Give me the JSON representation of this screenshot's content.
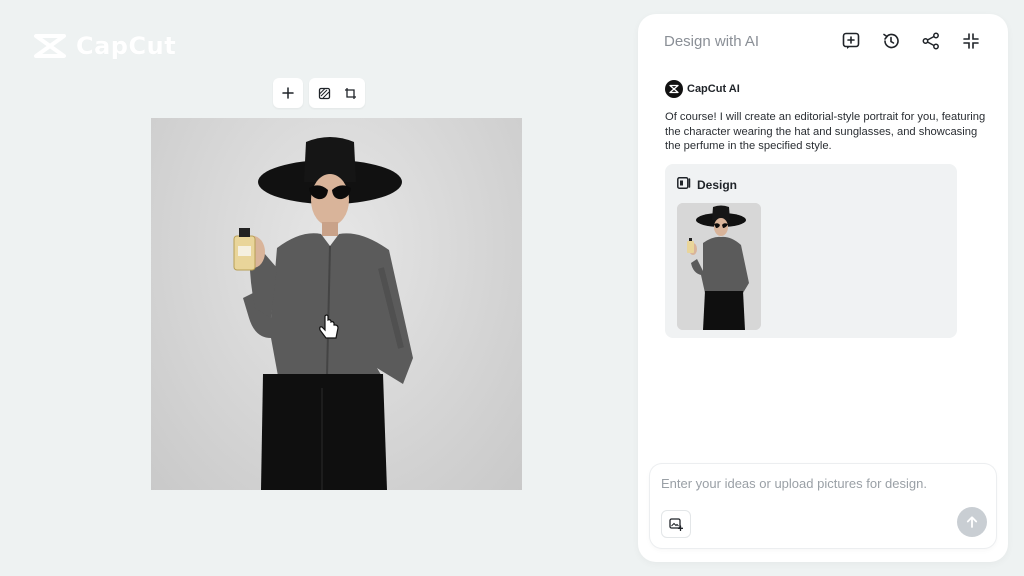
{
  "app": {
    "logo_text": "CapCut"
  },
  "canvas_toolbar": {
    "add_icon": "plus-icon",
    "image_icon": "image-edit-icon",
    "crop_icon": "crop-icon"
  },
  "canvas": {
    "image_subject": "editorial portrait"
  },
  "panel": {
    "title": "Design with AI",
    "header_icons": [
      "new-chat-icon",
      "history-icon",
      "share-icon",
      "minimize-icon"
    ],
    "ai_name": "CapCut AI",
    "ai_message": "Of course! I will create an editorial-style portrait for you, featuring the character wearing the hat and sunglasses, and showcasing the perfume in the specified style.",
    "design_card": {
      "label": "Design"
    },
    "input": {
      "placeholder": "Enter your ideas or upload pictures for design."
    }
  },
  "colors": {
    "background": "#eef2f2",
    "panel": "#ffffff",
    "card": "#f0f2f3",
    "send_disabled": "#c9ced3"
  }
}
